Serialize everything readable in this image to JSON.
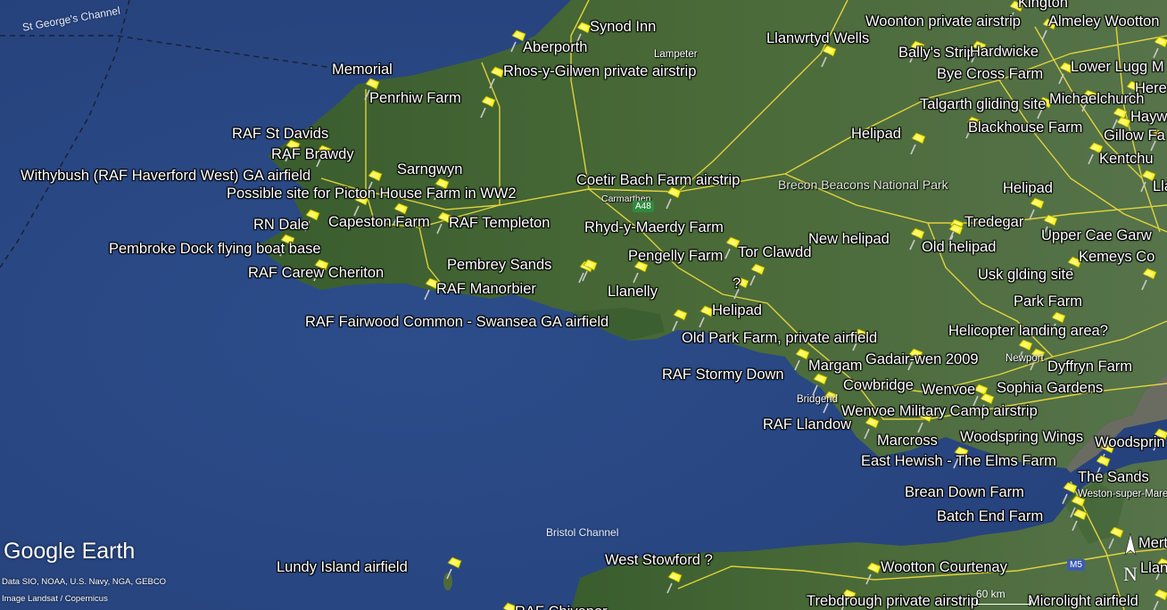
{
  "map": {
    "placemarks": [
      {
        "label": "Synod Inn"
      },
      {
        "label": "Aberporth"
      },
      {
        "label": "Rhos-y-Gilwen private airstrip"
      },
      {
        "label": "Memorial"
      },
      {
        "label": "Penrhiw Farm"
      },
      {
        "label": "RAF St Davids"
      },
      {
        "label": "RAF Brawdy"
      },
      {
        "label": "Withybush (RAF Haverford West) GA airfield"
      },
      {
        "label": "Sarngwyn"
      },
      {
        "label": "Possible site for Picton House Farm in WW2"
      },
      {
        "label": "Coetir Bach Farm airstrip"
      },
      {
        "label": "RN Dale"
      },
      {
        "label": "Capeston Farm"
      },
      {
        "label": "RAF Templeton"
      },
      {
        "label": "Rhyd-y-Maerdy Farm"
      },
      {
        "label": "Pembroke Dock flying boat base"
      },
      {
        "label": "Pengelly Farm"
      },
      {
        "label": "Tor Clawdd"
      },
      {
        "label": "Pembrey Sands"
      },
      {
        "label": "RAF Carew Cheriton"
      },
      {
        "label": "?"
      },
      {
        "label": "RAF Manorbier"
      },
      {
        "label": "Llanelly"
      },
      {
        "label": "Helipad"
      },
      {
        "label": "RAF Fairwood Common - Swansea GA airfield"
      },
      {
        "label": "Old Park Farm, private airfield"
      },
      {
        "label": "RAF Stormy Down"
      },
      {
        "label": "Margam"
      },
      {
        "label": "Gadair-wen 2009"
      },
      {
        "label": "Cowbridge"
      },
      {
        "label": "Wenvoe"
      },
      {
        "label": "Sophia Gardens"
      },
      {
        "label": "Wenvoe Military Camp airstrip"
      },
      {
        "label": "RAF Llandow"
      },
      {
        "label": "Marcross"
      },
      {
        "label": "Woodspring Wings"
      },
      {
        "label": "East Hewish - The Elms Farm"
      },
      {
        "label": "The Sands"
      },
      {
        "label": "Brean Down Farm"
      },
      {
        "label": "Batch End Farm"
      },
      {
        "label": "Lundy Island airfield"
      },
      {
        "label": "West Stowford ?"
      },
      {
        "label": "Wootton Courtenay"
      },
      {
        "label": "Trebdrough private airstrip"
      },
      {
        "label": "Microlight airfield"
      },
      {
        "label": "Kington"
      },
      {
        "label": "Woonton private airstrip"
      },
      {
        "label": "Almeley Wootton"
      },
      {
        "label": "Llanwrtyd Wells"
      },
      {
        "label": "Bally's Strip"
      },
      {
        "label": "Hardwicke"
      },
      {
        "label": "Bye Cross Farm"
      },
      {
        "label": "Lower Lugg M"
      },
      {
        "label": "Here"
      },
      {
        "label": "Michaelchurch"
      },
      {
        "label": "Talgarth gliding site"
      },
      {
        "label": "Haywo"
      },
      {
        "label": "Blackhouse Farm"
      },
      {
        "label": "Gillow Fa"
      },
      {
        "label": "Helipad"
      },
      {
        "label": "Kentchu"
      },
      {
        "label": "Helipad"
      },
      {
        "label": "Lla"
      },
      {
        "label": "Tredegar"
      },
      {
        "label": "Upper Cae Garw"
      },
      {
        "label": "New helipad"
      },
      {
        "label": "Old helipad"
      },
      {
        "label": "Kemeys Co"
      },
      {
        "label": "Usk glding site"
      },
      {
        "label": "Park Farm"
      },
      {
        "label": "Helicopter landing area?"
      },
      {
        "label": "Dyffryn Farm"
      },
      {
        "label": "Woodsprin"
      },
      {
        "label": "Merto"
      },
      {
        "label": "Llangor"
      },
      {
        "label": "RAF Chivenor"
      }
    ],
    "places": [
      {
        "label": "Lampeter"
      },
      {
        "label": "Carmarthen"
      },
      {
        "label": "Brecon Beacons National Park"
      },
      {
        "label": "Bridgend"
      },
      {
        "label": "Newport"
      },
      {
        "label": "Weston-super-Mare"
      }
    ],
    "sea_labels": [
      {
        "label": "St George's Channel"
      },
      {
        "label": "Bristol Channel"
      }
    ],
    "roads": [
      "A48",
      "M5"
    ],
    "attribution": {
      "logo_google": "Google",
      "logo_earth": "Earth",
      "data_line": "Data SIO, NOAA, U.S. Navy, NGA, GEBCO",
      "image_line": "Image Landsat / Copernicus"
    },
    "compass_letter": "N",
    "scale_label": "60 km",
    "colors": {
      "sea": "#2a4a85",
      "land": "#355a2c",
      "roads": "#f0de3c",
      "pins": "#f7f223"
    }
  }
}
